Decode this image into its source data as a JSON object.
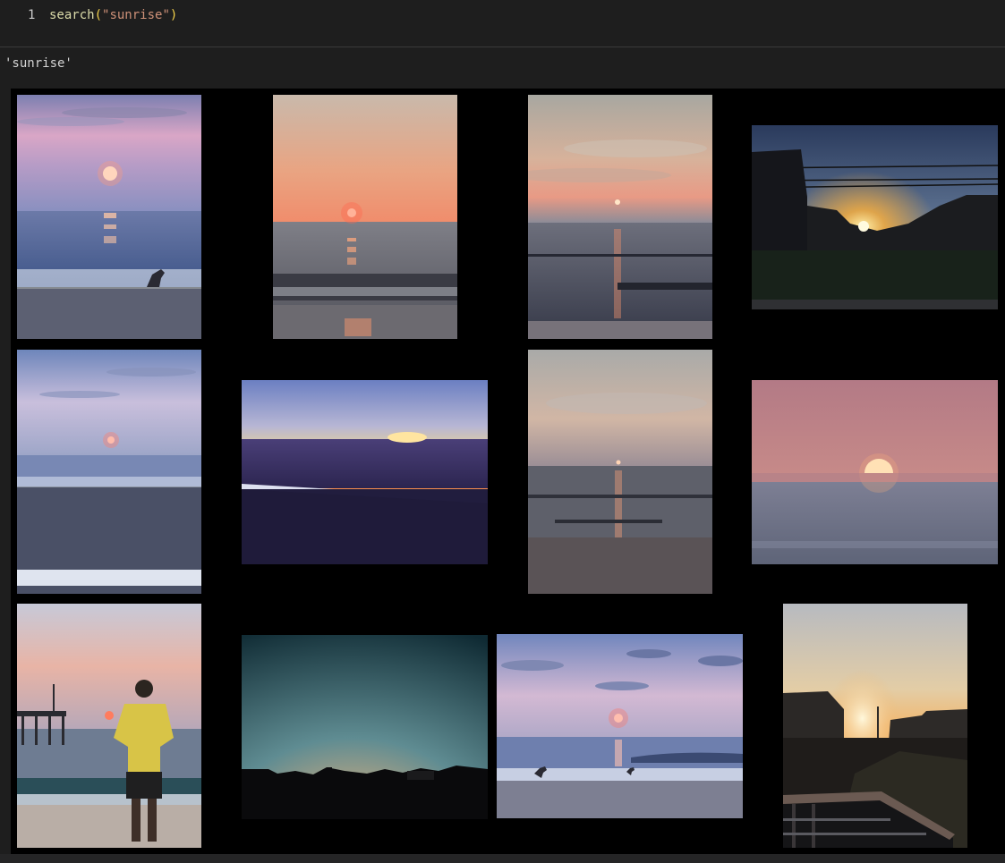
{
  "cell": {
    "line_number": "1",
    "code": {
      "fn": "search",
      "open": "(",
      "arg": "\"sunrise\"",
      "close": ")"
    },
    "output_text": "'sunrise'"
  },
  "gallery": {
    "photos": [
      {
        "name": "sunrise-photo-1",
        "subject": "pink sky, sun over sea, seagull on beach"
      },
      {
        "name": "sunrise-photo-2",
        "subject": "orange sky, sun on horizon, wave"
      },
      {
        "name": "sunrise-photo-3",
        "subject": "cloudy sky, sun reflection on sea"
      },
      {
        "name": "sunrise-photo-4",
        "subject": "houses silhouette, power lines, sun glare"
      },
      {
        "name": "sunrise-photo-5",
        "subject": "pale blue sky, sun over sea, wet beach"
      },
      {
        "name": "sunrise-photo-6",
        "subject": "bright yellow horizon, dark water"
      },
      {
        "name": "sunrise-photo-7",
        "subject": "grey sky, sun low, footprints on sand"
      },
      {
        "name": "sunrise-photo-8",
        "subject": "pink sky, large sun half above sea"
      },
      {
        "name": "sunrise-photo-9",
        "subject": "man in yellow shirt, pier, sunrise"
      },
      {
        "name": "sunrise-photo-10",
        "subject": "dark teal sky, orange horizon, skyline"
      },
      {
        "name": "sunrise-photo-11",
        "subject": "clouds, sun over sea, seagulls on beach"
      },
      {
        "name": "sunrise-photo-12",
        "subject": "houses, railing, sun between buildings"
      }
    ]
  }
}
